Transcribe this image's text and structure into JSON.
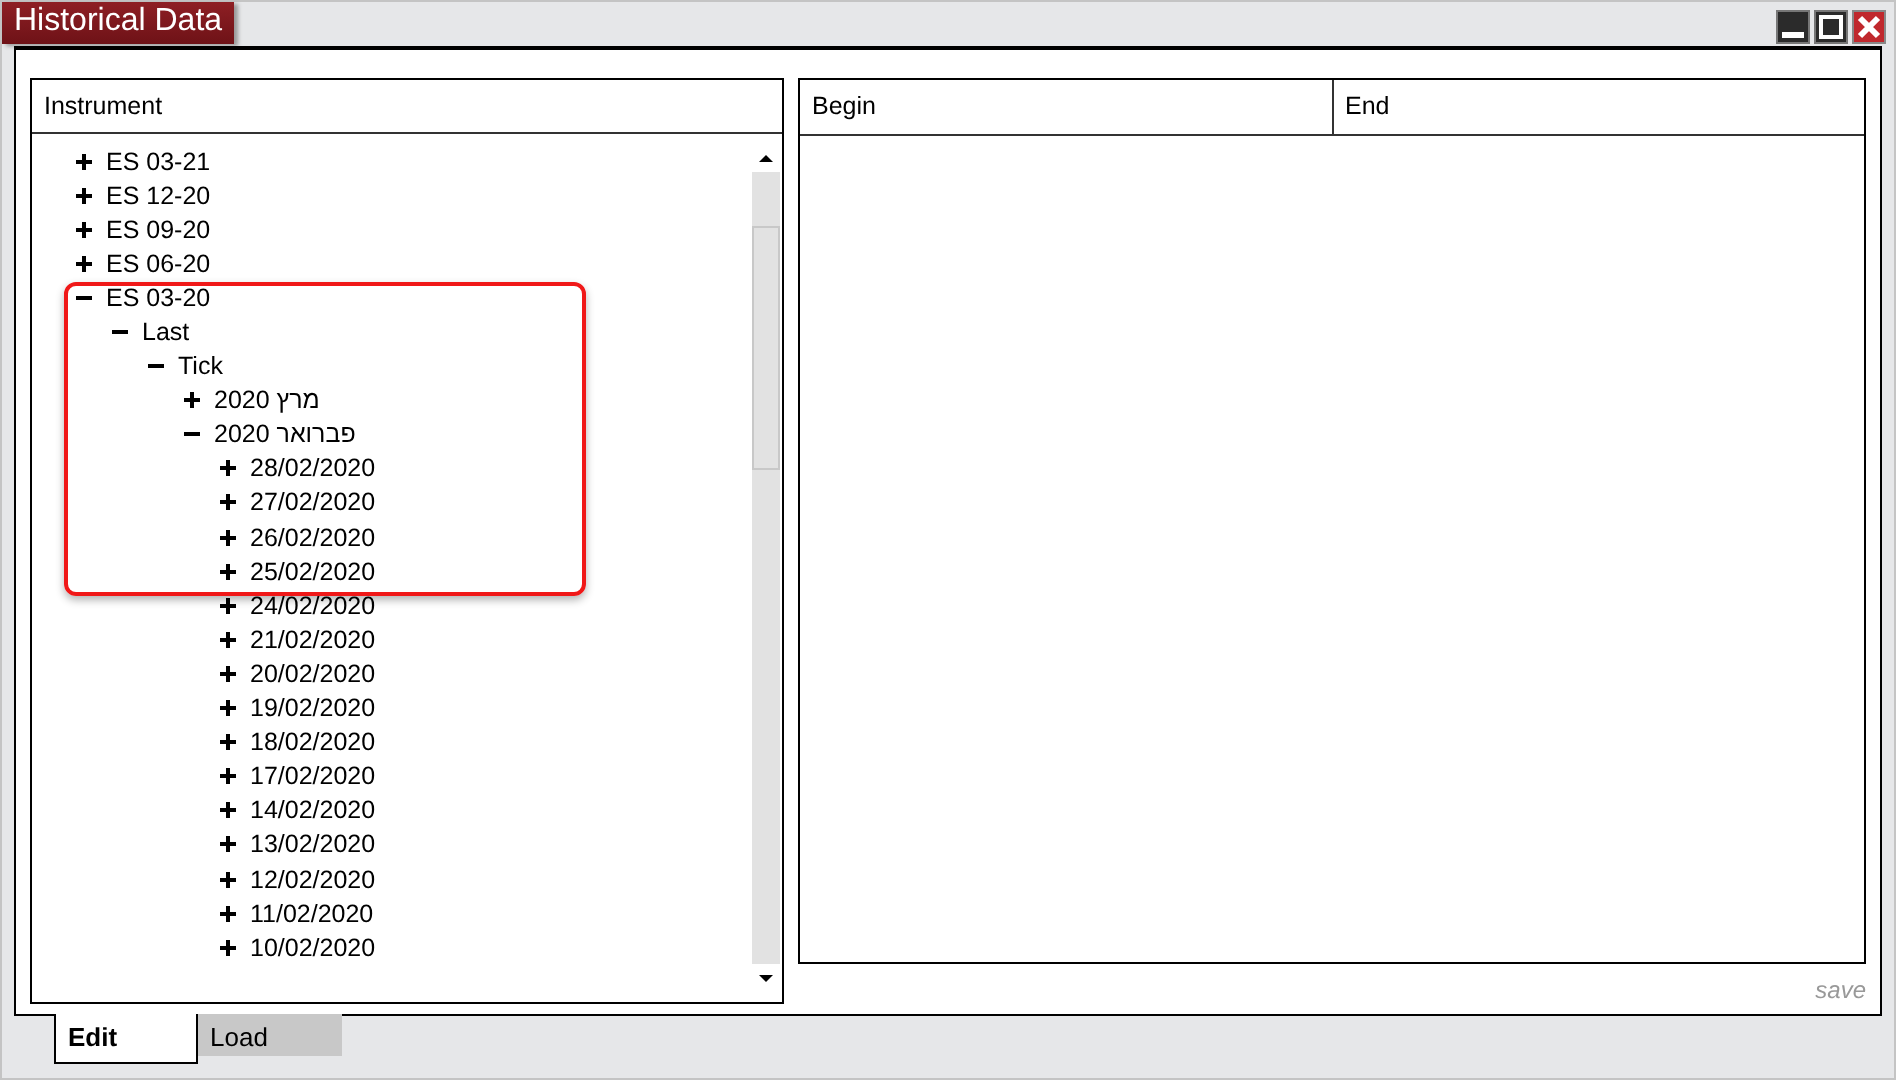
{
  "window": {
    "title": "Historical Data"
  },
  "instrument_tree": {
    "column": "Instrument",
    "items": [
      {
        "label": "ES 03-21",
        "expanded": false
      },
      {
        "label": "ES 12-20",
        "expanded": false
      },
      {
        "label": "ES 09-20",
        "expanded": false
      },
      {
        "label": "ES 06-20",
        "expanded": false
      },
      {
        "label": "ES 03-20",
        "expanded": true,
        "children": [
          {
            "label": "Last",
            "expanded": true,
            "children": [
              {
                "label": "Tick",
                "expanded": true,
                "children": [
                  {
                    "label": "2020 מרץ",
                    "expanded": false
                  },
                  {
                    "label": "2020 פברואר",
                    "expanded": true,
                    "children": [
                      {
                        "label": "28/02/2020",
                        "expanded": false
                      },
                      {
                        "label": "27/02/2020",
                        "expanded": false
                      },
                      {
                        "label": "26/02/2020",
                        "expanded": false
                      },
                      {
                        "label": "25/02/2020",
                        "expanded": false
                      },
                      {
                        "label": "24/02/2020",
                        "expanded": false
                      },
                      {
                        "label": "21/02/2020",
                        "expanded": false
                      },
                      {
                        "label": "20/02/2020",
                        "expanded": false
                      },
                      {
                        "label": "19/02/2020",
                        "expanded": false
                      },
                      {
                        "label": "18/02/2020",
                        "expanded": false
                      },
                      {
                        "label": "17/02/2020",
                        "expanded": false
                      },
                      {
                        "label": "14/02/2020",
                        "expanded": false
                      },
                      {
                        "label": "13/02/2020",
                        "expanded": false
                      },
                      {
                        "label": "12/02/2020",
                        "expanded": false
                      },
                      {
                        "label": "11/02/2020",
                        "expanded": false
                      },
                      {
                        "label": "10/02/2020",
                        "expanded": false
                      }
                    ]
                  }
                ]
              }
            ]
          }
        ]
      }
    ]
  },
  "range_table": {
    "columns": [
      "Begin",
      "End"
    ]
  },
  "save_label": "save",
  "tabs": [
    {
      "label": "Edit",
      "selected": true
    },
    {
      "label": "Load",
      "selected": false
    }
  ]
}
